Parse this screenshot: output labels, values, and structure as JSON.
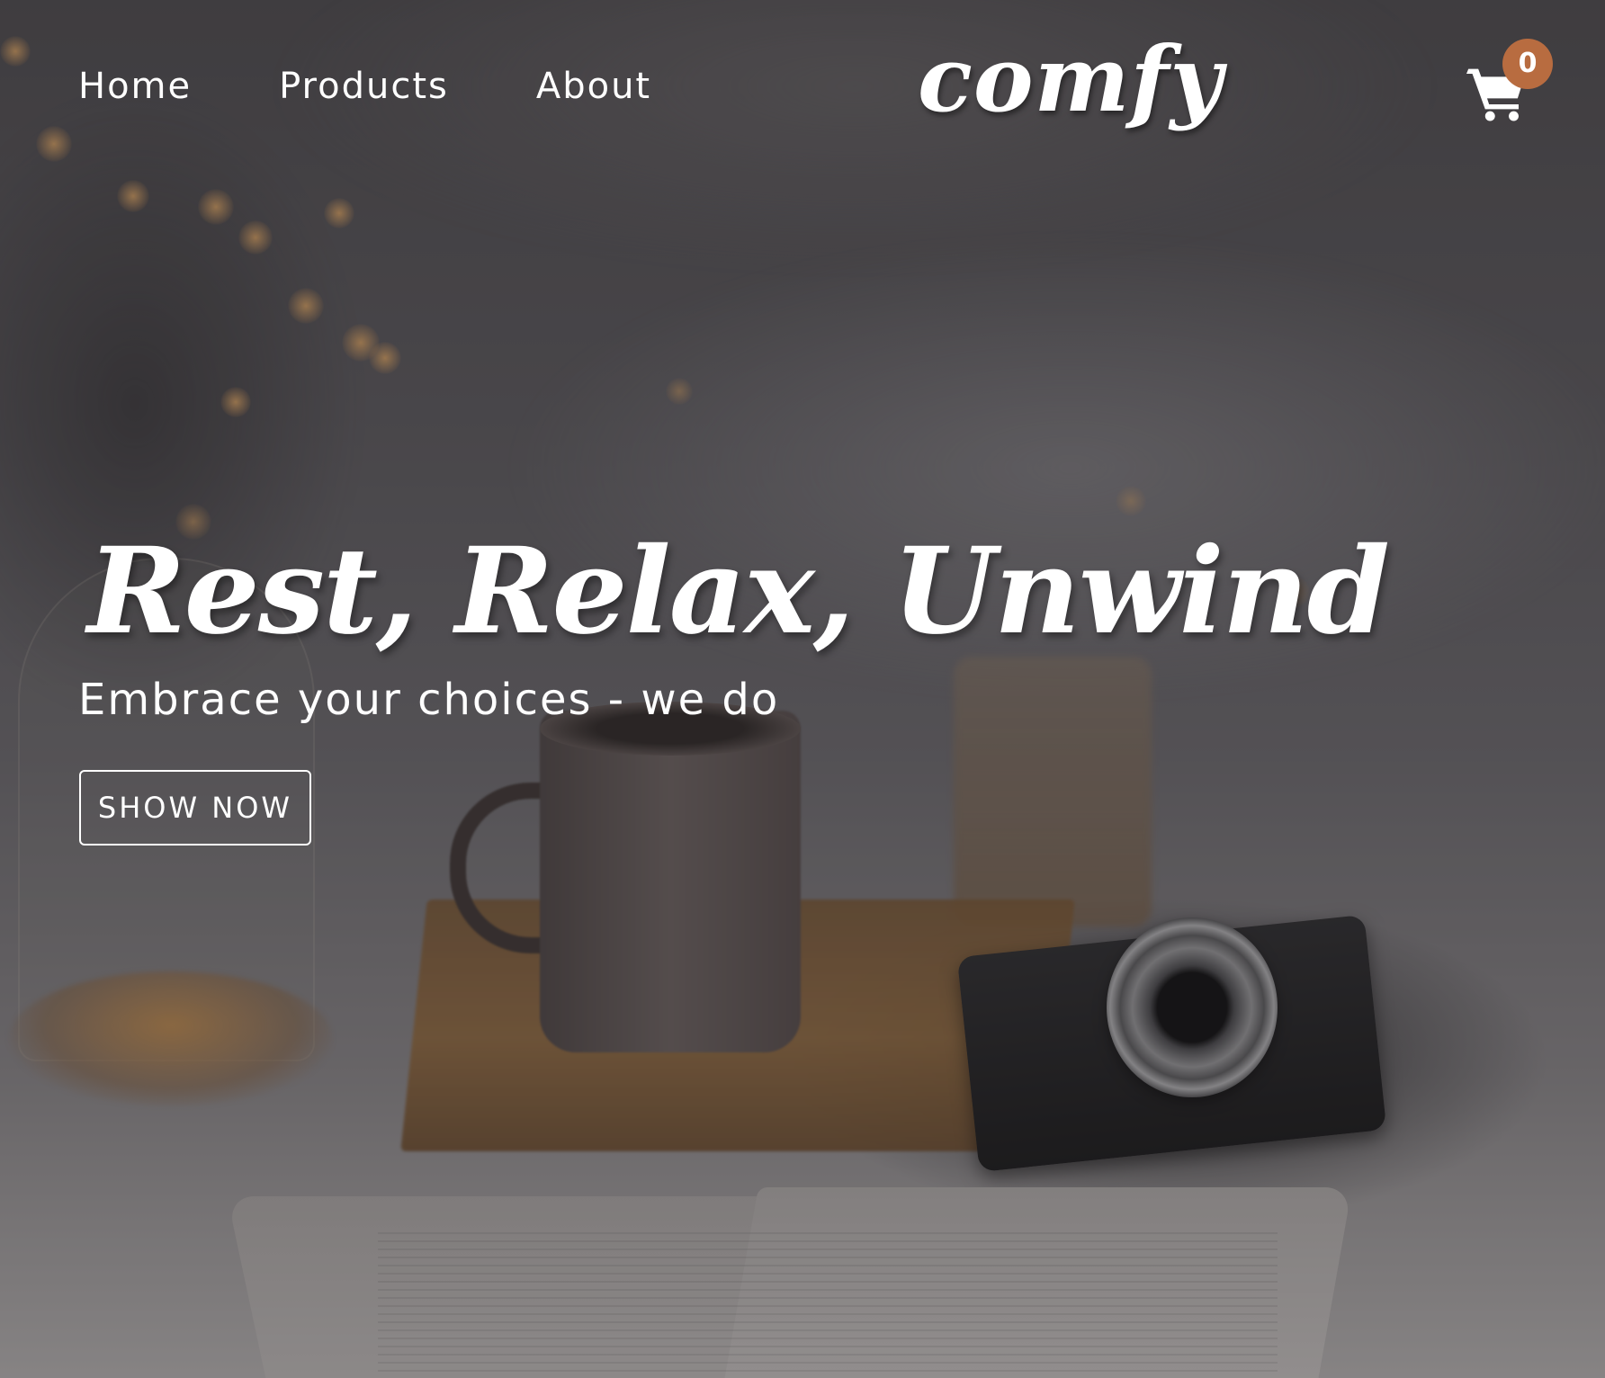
{
  "nav": {
    "links": [
      {
        "label": "Home"
      },
      {
        "label": "Products"
      },
      {
        "label": "About"
      }
    ],
    "logo": "comfy",
    "cart": {
      "icon": "shopping-cart-icon",
      "count": "0"
    }
  },
  "hero": {
    "title": "Rest, Relax, Unwind",
    "subtitle": "Embrace your choices - we do",
    "button_label": "SHOW NOW"
  },
  "colors": {
    "accent": "#b86c40",
    "text": "#ffffff"
  }
}
